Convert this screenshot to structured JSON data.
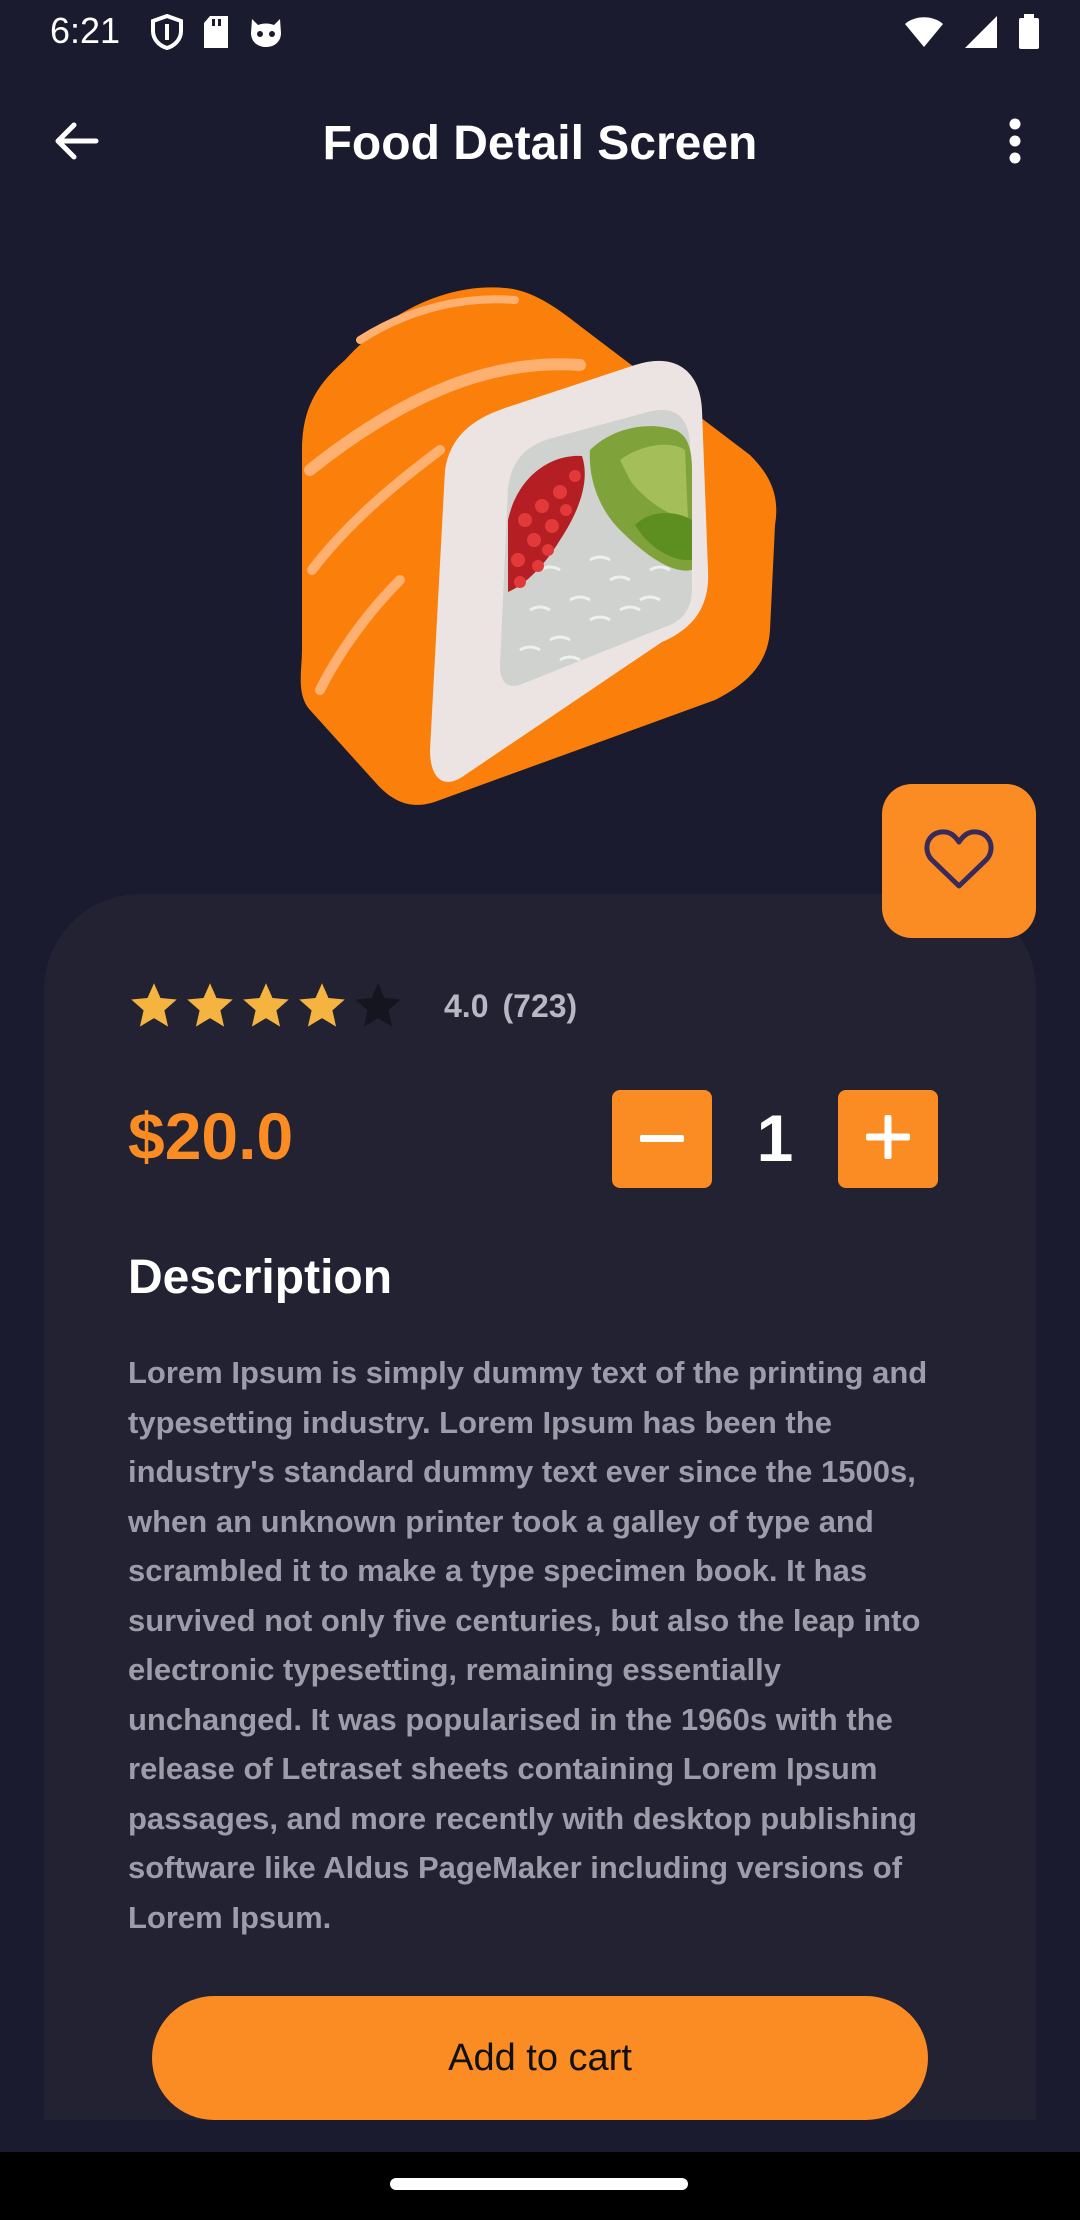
{
  "status_bar": {
    "time": "6:21",
    "left_icons": [
      "shield-icon",
      "sd-card-icon",
      "cat-face-icon"
    ],
    "right_icons": [
      "wifi-icon",
      "signal-icon",
      "battery-icon"
    ]
  },
  "app_bar": {
    "title": "Food Detail Screen",
    "back_icon": "arrow-back-icon",
    "more_icon": "more-vertical-icon"
  },
  "product": {
    "image": "sushi-roll-illustration",
    "rating_value": "4.0",
    "rating_count": "(723)",
    "stars": [
      1,
      1,
      1,
      1,
      0
    ],
    "price": "$20.0",
    "quantity": "1"
  },
  "description": {
    "title": "Description",
    "body": "Lorem Ipsum is simply dummy text of the printing and typesetting industry. Lorem Ipsum has been the industry's standard dummy text ever since the 1500s, when an unknown printer took a galley of type and scrambled it to make a type specimen book. It has survived not only five centuries, but also the leap into electronic typesetting, remaining essentially unchanged. It was popularised in the 1960s with the release of Letraset sheets containing Lorem Ipsum passages, and more recently with desktop publishing software like Aldus PageMaker including versions of Lorem Ipsum."
  },
  "actions": {
    "add_to_cart": "Add to cart",
    "favorite_icon": "heart-outline-icon"
  },
  "colors": {
    "background": "#1b1b2f",
    "card": "#222233",
    "accent": "#fb8c24",
    "star_filled": "#f5b43f",
    "star_empty": "#15151f",
    "body_text": "#9c9caa"
  }
}
